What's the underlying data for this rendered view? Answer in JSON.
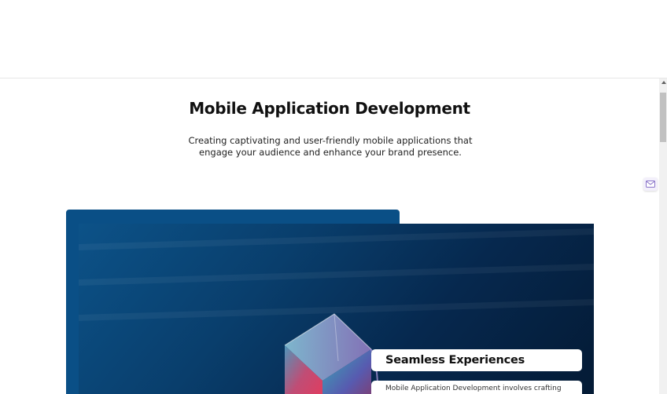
{
  "section": {
    "title": "Mobile Application Development",
    "description": "Creating captivating and user-friendly mobile applications that engage your audience and enhance your brand presence."
  },
  "feature_card": {
    "title": "Seamless Experiences",
    "body": "Mobile Application Development involves crafting"
  },
  "floating_widget": {
    "icon": "mail-icon"
  },
  "colors": {
    "frame_blue": "#0a4f86",
    "image_dark": "#041a34",
    "page_background": "#ffffff"
  }
}
